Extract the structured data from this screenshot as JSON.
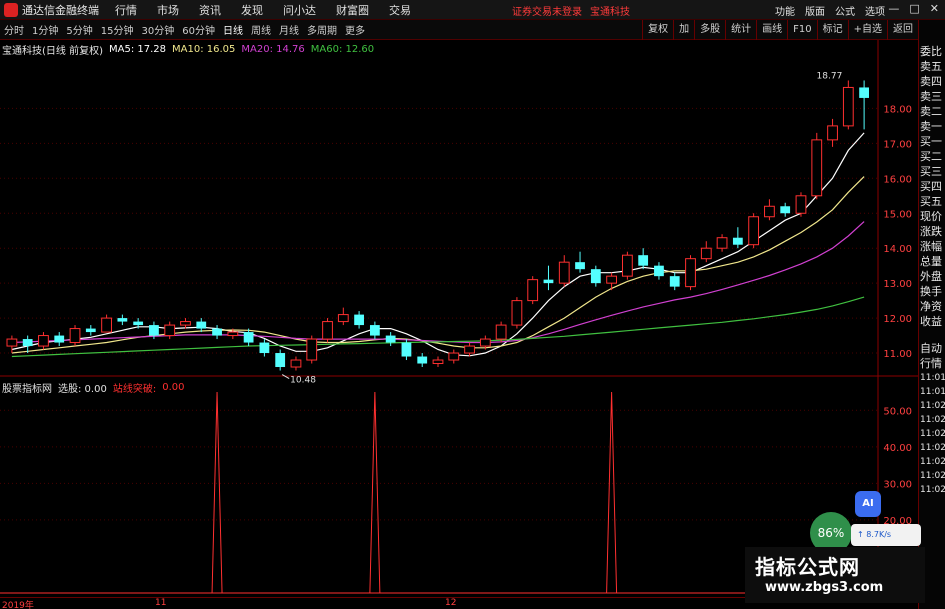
{
  "window": {
    "app_title": "通达信金融终端",
    "menus": [
      "行情",
      "市场",
      "资讯",
      "发现",
      "问小达",
      "财富圈",
      "交易"
    ],
    "notice": "证券交易未登录",
    "stock_name": "宝通科技",
    "right_menus": [
      "功能",
      "版面",
      "公式",
      "选项"
    ],
    "win_controls": [
      "—",
      "□",
      "✕"
    ]
  },
  "toolbar": {
    "periods": [
      "分时",
      "1分钟",
      "5分钟",
      "15分钟",
      "30分钟",
      "60分钟",
      "日线",
      "周线",
      "月线",
      "多周期",
      "更多"
    ],
    "active_period": "日线",
    "buttons": [
      "复权",
      "加",
      "多股",
      "统计",
      "画线",
      "F10",
      "标记",
      "+自选",
      "返回"
    ]
  },
  "legend": {
    "stock": "宝通科技(日线 前复权)",
    "ma5": "MA5: 17.28",
    "ma10": "MA10: 16.05",
    "ma20": "MA20: 14.76",
    "ma60": "MA60: 12.60",
    "colors": {
      "ma5": "#ffffff",
      "ma10": "#f0e68c",
      "ma20": "#d040d0",
      "ma60": "#40c040"
    }
  },
  "indicator": {
    "name": "股票指标网",
    "select_label": "选股: 0.00",
    "signal_label": "站线突破:",
    "signal_value": "0.00",
    "colors": {
      "select": "#e0e0e0",
      "signal": "#ff3030"
    }
  },
  "annotations": {
    "high": "18.77",
    "low": "10.48"
  },
  "axis": {
    "price_ticks": [
      "18.00",
      "17.00",
      "16.00",
      "15.00",
      "14.00",
      "13.00",
      "12.00",
      "11.00"
    ],
    "ind_ticks": [
      "50.00",
      "40.00",
      "30.00",
      "20.00"
    ],
    "dates": [
      "2019年",
      "11",
      "12"
    ]
  },
  "side_panel": {
    "top_labels": [
      "委比",
      "卖五",
      "卖四",
      "卖三",
      "卖二",
      "卖一",
      "买一",
      "买二",
      "买三",
      "买四",
      "买五",
      "现价",
      "涨跌",
      "涨幅",
      "总量",
      "外盘",
      "换手",
      "净资",
      "收益"
    ],
    "bottom_labels": [
      "自动",
      "行情",
      "11:01",
      "11:01",
      "11:02",
      "11:02",
      "11:02",
      "11:02",
      "11:02",
      "11:02",
      "11:02"
    ]
  },
  "widgets": {
    "ai": "AI",
    "speed": "86%",
    "net": "8.7K/s",
    "watermark_title": "指标公式网",
    "watermark_url": "www.zbgs3.com"
  },
  "chart_data": [
    {
      "type": "candlestick",
      "title": "宝通科技(日线 前复权)",
      "ylim": [
        10.4,
        19.5
      ],
      "up_color": "#ff3030",
      "down_color": "#54ffff",
      "ohlc": [
        [
          11.2,
          11.5,
          11.0,
          11.4
        ],
        [
          11.4,
          11.5,
          11.0,
          11.2
        ],
        [
          11.2,
          11.6,
          11.1,
          11.5
        ],
        [
          11.5,
          11.6,
          11.2,
          11.3
        ],
        [
          11.3,
          11.8,
          11.2,
          11.7
        ],
        [
          11.7,
          11.8,
          11.5,
          11.6
        ],
        [
          11.6,
          12.1,
          11.6,
          12.0
        ],
        [
          12.0,
          12.1,
          11.8,
          11.9
        ],
        [
          11.9,
          12.0,
          11.7,
          11.8
        ],
        [
          11.8,
          11.9,
          11.4,
          11.5
        ],
        [
          11.5,
          11.9,
          11.4,
          11.8
        ],
        [
          11.8,
          12.0,
          11.7,
          11.9
        ],
        [
          11.9,
          12.0,
          11.6,
          11.7
        ],
        [
          11.7,
          11.8,
          11.4,
          11.5
        ],
        [
          11.5,
          11.7,
          11.4,
          11.6
        ],
        [
          11.6,
          11.7,
          11.2,
          11.3
        ],
        [
          11.3,
          11.4,
          10.9,
          11.0
        ],
        [
          11.0,
          11.1,
          10.5,
          10.6
        ],
        [
          10.6,
          10.9,
          10.5,
          10.8
        ],
        [
          10.8,
          11.5,
          10.7,
          11.4
        ],
        [
          11.4,
          12.0,
          11.3,
          11.9
        ],
        [
          11.9,
          12.3,
          11.8,
          12.1
        ],
        [
          12.1,
          12.2,
          11.7,
          11.8
        ],
        [
          11.8,
          11.9,
          11.4,
          11.5
        ],
        [
          11.5,
          11.6,
          11.2,
          11.3
        ],
        [
          11.3,
          11.4,
          10.8,
          10.9
        ],
        [
          10.9,
          11.0,
          10.6,
          10.7
        ],
        [
          10.7,
          10.9,
          10.6,
          10.8
        ],
        [
          10.8,
          11.1,
          10.7,
          11.0
        ],
        [
          11.0,
          11.3,
          10.9,
          11.2
        ],
        [
          11.2,
          11.5,
          11.1,
          11.4
        ],
        [
          11.4,
          11.9,
          11.3,
          11.8
        ],
        [
          11.8,
          12.6,
          11.7,
          12.5
        ],
        [
          12.5,
          13.2,
          12.4,
          13.1
        ],
        [
          13.1,
          13.5,
          12.8,
          13.0
        ],
        [
          13.0,
          13.8,
          12.9,
          13.6
        ],
        [
          13.6,
          13.9,
          13.3,
          13.4
        ],
        [
          13.4,
          13.5,
          12.9,
          13.0
        ],
        [
          13.0,
          13.3,
          12.8,
          13.2
        ],
        [
          13.2,
          13.9,
          13.1,
          13.8
        ],
        [
          13.8,
          14.0,
          13.4,
          13.5
        ],
        [
          13.5,
          13.6,
          13.1,
          13.2
        ],
        [
          13.2,
          13.3,
          12.8,
          12.9
        ],
        [
          12.9,
          13.8,
          12.8,
          13.7
        ],
        [
          13.7,
          14.2,
          13.6,
          14.0
        ],
        [
          14.0,
          14.4,
          13.9,
          14.3
        ],
        [
          14.3,
          14.6,
          14.0,
          14.1
        ],
        [
          14.1,
          15.0,
          14.0,
          14.9
        ],
        [
          14.9,
          15.4,
          14.8,
          15.2
        ],
        [
          15.2,
          15.3,
          14.9,
          15.0
        ],
        [
          15.0,
          15.6,
          14.9,
          15.5
        ],
        [
          15.5,
          17.3,
          15.4,
          17.1
        ],
        [
          17.1,
          17.7,
          16.9,
          17.5
        ],
        [
          17.5,
          18.8,
          17.4,
          18.6
        ],
        [
          18.6,
          18.8,
          17.4,
          18.3
        ]
      ],
      "series": [
        {
          "name": "MA5",
          "values": [
            11.1,
            11.2,
            11.3,
            11.35,
            11.4,
            11.45,
            11.55,
            11.65,
            11.75,
            11.75,
            11.7,
            11.72,
            11.74,
            11.7,
            11.62,
            11.58,
            11.42,
            11.2,
            11.05,
            11.05,
            11.15,
            11.35,
            11.55,
            11.7,
            11.7,
            11.55,
            11.35,
            11.1,
            10.95,
            10.92,
            11.0,
            11.2,
            11.55,
            12.0,
            12.5,
            12.9,
            13.2,
            13.3,
            13.3,
            13.35,
            13.45,
            13.4,
            13.3,
            13.3,
            13.5,
            13.7,
            13.9,
            14.2,
            14.5,
            14.8,
            15.0,
            15.5,
            16.0,
            16.8,
            17.3
          ]
        },
        {
          "name": "MA10",
          "values": [
            11.0,
            11.05,
            11.1,
            11.15,
            11.2,
            11.25,
            11.3,
            11.38,
            11.45,
            11.5,
            11.55,
            11.6,
            11.63,
            11.65,
            11.66,
            11.65,
            11.6,
            11.5,
            11.4,
            11.32,
            11.3,
            11.3,
            11.33,
            11.38,
            11.42,
            11.4,
            11.35,
            11.28,
            11.2,
            11.15,
            11.15,
            11.2,
            11.3,
            11.5,
            11.75,
            12.0,
            12.3,
            12.6,
            12.85,
            13.05,
            13.2,
            13.3,
            13.35,
            13.35,
            13.4,
            13.5,
            13.6,
            13.75,
            13.95,
            14.2,
            14.45,
            14.75,
            15.1,
            15.6,
            16.05
          ]
        },
        {
          "name": "MA20",
          "values": [
            11.3,
            11.32,
            11.34,
            11.36,
            11.38,
            11.4,
            11.42,
            11.44,
            11.46,
            11.48,
            11.5,
            11.52,
            11.52,
            11.52,
            11.52,
            11.5,
            11.48,
            11.45,
            11.42,
            11.4,
            11.4,
            11.4,
            11.4,
            11.4,
            11.4,
            11.38,
            11.36,
            11.34,
            11.32,
            11.3,
            11.3,
            11.32,
            11.36,
            11.44,
            11.55,
            11.68,
            11.82,
            11.95,
            12.08,
            12.2,
            12.32,
            12.42,
            12.52,
            12.6,
            12.7,
            12.82,
            12.95,
            13.08,
            13.22,
            13.38,
            13.55,
            13.75,
            14.0,
            14.35,
            14.76
          ]
        },
        {
          "name": "MA60",
          "values": [
            10.9,
            10.92,
            10.94,
            10.96,
            10.98,
            11.0,
            11.02,
            11.04,
            11.06,
            11.08,
            11.1,
            11.12,
            11.14,
            11.16,
            11.18,
            11.2,
            11.21,
            11.22,
            11.23,
            11.24,
            11.25,
            11.26,
            11.27,
            11.28,
            11.29,
            11.3,
            11.31,
            11.32,
            11.33,
            11.34,
            11.35,
            11.37,
            11.39,
            11.42,
            11.45,
            11.48,
            11.52,
            11.56,
            11.6,
            11.64,
            11.68,
            11.72,
            11.76,
            11.8,
            11.84,
            11.88,
            11.93,
            11.98,
            12.04,
            12.1,
            12.17,
            12.25,
            12.35,
            12.47,
            12.6
          ]
        }
      ]
    },
    {
      "type": "bar",
      "title": "股票指标网",
      "ylim": [
        0,
        55
      ],
      "spike_indices": [
        13,
        23,
        38
      ],
      "spike_values": [
        55,
        55,
        55
      ],
      "baseline_values": [
        0
      ],
      "colors": {
        "spike": "#ff3030"
      }
    }
  ]
}
